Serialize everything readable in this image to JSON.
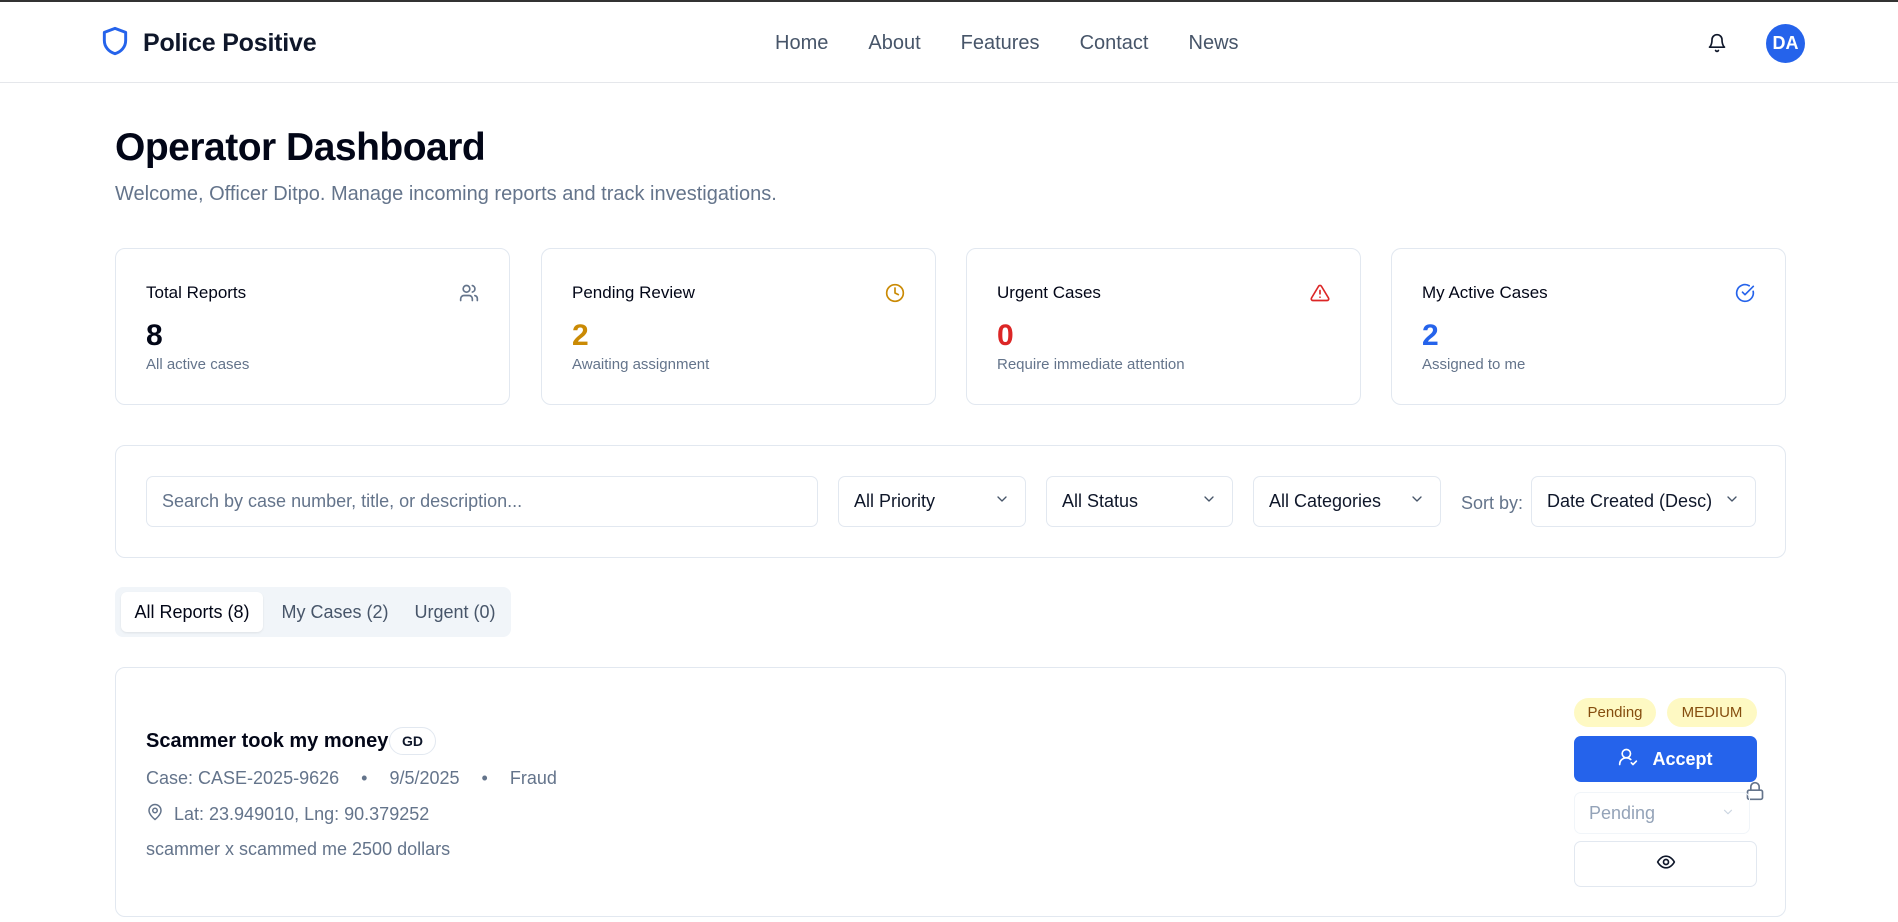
{
  "brand": {
    "name": "Police Positive",
    "accent": "#2563eb"
  },
  "nav": {
    "items": [
      "Home",
      "About",
      "Features",
      "Contact",
      "News"
    ]
  },
  "user": {
    "initials": "DA"
  },
  "page": {
    "title": "Operator Dashboard",
    "subtitle": "Welcome, Officer Ditpo. Manage incoming reports and track investigations."
  },
  "stats": [
    {
      "title": "Total Reports",
      "value": "8",
      "desc": "All active cases",
      "icon": "users-icon",
      "color": "#020617"
    },
    {
      "title": "Pending Review",
      "value": "2",
      "desc": "Awaiting assignment",
      "icon": "clock-icon",
      "color": "#ca8a04"
    },
    {
      "title": "Urgent Cases",
      "value": "0",
      "desc": "Require immediate attention",
      "icon": "alert-triangle-icon",
      "color": "#dc2626"
    },
    {
      "title": "My Active Cases",
      "value": "2",
      "desc": "Assigned to me",
      "icon": "check-circle-icon",
      "color": "#2563eb"
    }
  ],
  "filters": {
    "search_placeholder": "Search by case number, title, or description...",
    "priority": "All Priority",
    "status": "All Status",
    "category": "All Categories",
    "sort_label": "Sort by:",
    "sort_value": "Date Created (Desc)"
  },
  "tabs": [
    "All Reports (8)",
    "My Cases (2)",
    "Urgent (0)"
  ],
  "active_tab": "All Reports (8)",
  "report": {
    "title": "Scammer took my money",
    "badge": "GD",
    "case": "Case: CASE-2025-9626",
    "date": "9/5/2025",
    "category": "Fraud",
    "separator": "•",
    "location": "Lat: 23.949010, Lng: 90.379252",
    "description": "scammer x scammed me 2500 dollars",
    "status_badge": "Pending",
    "priority_badge": "MEDIUM",
    "accept_label": "Accept",
    "status_select": "Pending"
  }
}
